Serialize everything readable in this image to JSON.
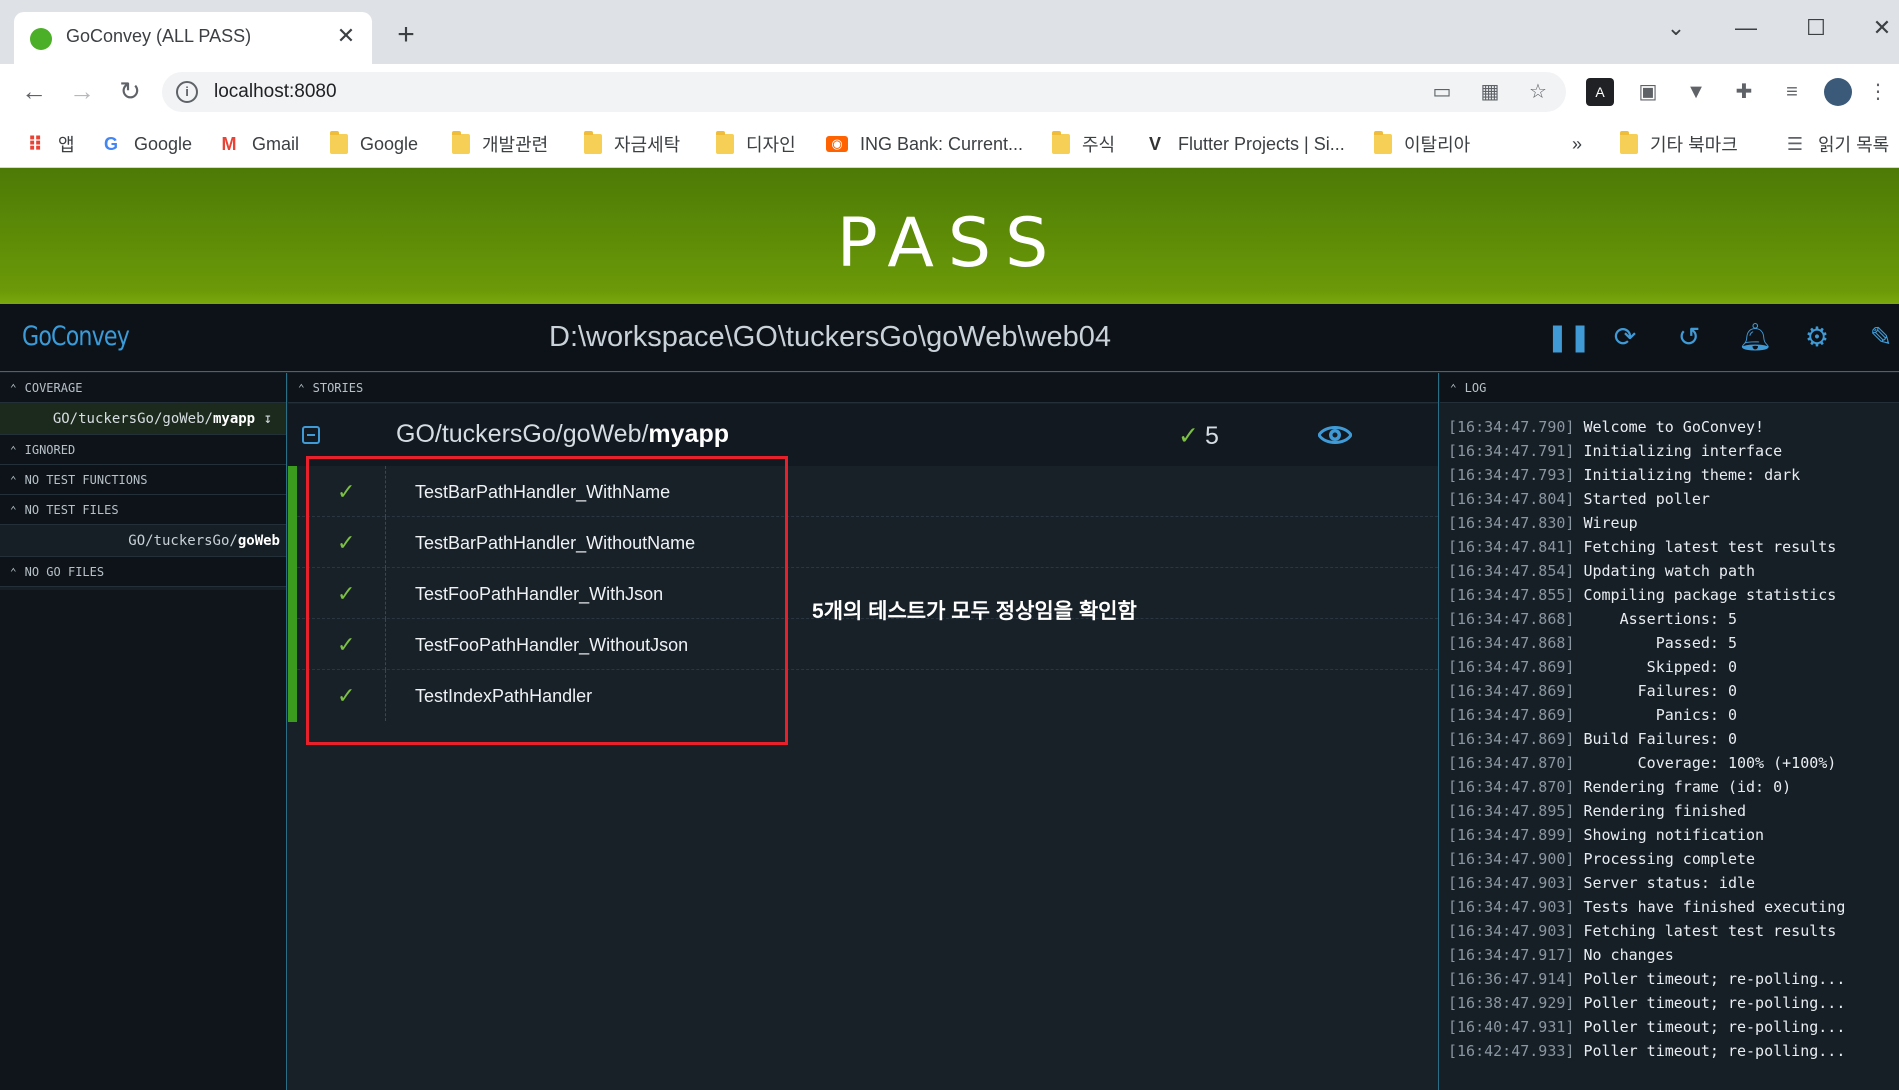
{
  "browser": {
    "tab_title": "GoConvey (ALL PASS)",
    "close_glyph": "✕",
    "new_tab_glyph": "+",
    "url": "localhost:8080",
    "bookmarks": [
      {
        "label": "앱",
        "icon": "apps-grid-icon"
      },
      {
        "label": "Google",
        "icon": "google-g-icon"
      },
      {
        "label": "Gmail",
        "icon": "gmail-icon"
      },
      {
        "label": "Google",
        "icon": "folder-icon"
      },
      {
        "label": "개발관련",
        "icon": "folder-icon"
      },
      {
        "label": "자금세탁",
        "icon": "folder-icon"
      },
      {
        "label": "디자인",
        "icon": "folder-icon"
      },
      {
        "label": "ING Bank: Current...",
        "icon": "ing-icon"
      },
      {
        "label": "주식",
        "icon": "folder-icon"
      },
      {
        "label": "Flutter Projects | Si...",
        "icon": "v-icon"
      },
      {
        "label": "이탈리아",
        "icon": "folder-icon"
      },
      {
        "label": "기타 북마크",
        "icon": "folder-icon"
      },
      {
        "label": "읽기 목록",
        "icon": "reading-list-icon"
      }
    ],
    "bookmarks_overflow": "»"
  },
  "banner": {
    "status": "PASS",
    "color": "#6b9908"
  },
  "header": {
    "logo": "GoConvey",
    "path": "D:\\workspace\\GO\\tuckersGo\\goWeb\\web04",
    "icons": [
      "pause-icon",
      "refresh-icon",
      "history-icon",
      "bell-icon",
      "gear-icon",
      "edit-icon"
    ]
  },
  "sidebar": {
    "coverage_title": "COVERAGE",
    "coverage_pkg_prefix": "GO/tuckersGo/goWeb/",
    "coverage_pkg_name": "myapp",
    "coverage_pkg_suffix": "↧",
    "ignored_title": "IGNORED",
    "no_test_functions_title": "NO TEST FUNCTIONS",
    "no_test_files_title": "NO TEST FILES",
    "no_test_files_pkg_prefix": "GO/tuckersGo/",
    "no_test_files_pkg_name": "goWeb",
    "no_go_files_title": "NO GO FILES"
  },
  "stories": {
    "title": "STORIES",
    "package_prefix": "GO/tuckersGo/goWeb/",
    "package_name": "myapp",
    "pass_mark": "✓",
    "pass_count": "5",
    "tests": [
      {
        "name": "TestBarPathHandler_WithName",
        "mark": "✓"
      },
      {
        "name": "TestBarPathHandler_WithoutName",
        "mark": "✓"
      },
      {
        "name": "TestFooPathHandler_WithJson",
        "mark": "✓"
      },
      {
        "name": "TestFooPathHandler_WithoutJson",
        "mark": "✓"
      },
      {
        "name": "TestIndexPathHandler",
        "mark": "✓"
      }
    ],
    "annotation_bold": "5",
    "annotation_text": "개의 테스트가 모두 정상임을 확인함",
    "highlight_color": "#e8202b",
    "pass_color": "#7bc043"
  },
  "log": {
    "title": "LOG",
    "lines": [
      {
        "ts": "[16:34:47.790]",
        "msg": "Welcome to GoConvey!"
      },
      {
        "ts": "[16:34:47.791]",
        "msg": "Initializing interface"
      },
      {
        "ts": "[16:34:47.793]",
        "msg": "Initializing theme: dark"
      },
      {
        "ts": "[16:34:47.804]",
        "msg": "Started poller"
      },
      {
        "ts": "[16:34:47.830]",
        "msg": "Wireup"
      },
      {
        "ts": "[16:34:47.841]",
        "msg": "Fetching latest test results"
      },
      {
        "ts": "[16:34:47.854]",
        "msg": "Updating watch path"
      },
      {
        "ts": "[16:34:47.855]",
        "msg": "Compiling package statistics"
      },
      {
        "ts": "[16:34:47.868]",
        "msg": "    Assertions: 5"
      },
      {
        "ts": "[16:34:47.868]",
        "msg": "        Passed: 5"
      },
      {
        "ts": "[16:34:47.869]",
        "msg": "       Skipped: 0"
      },
      {
        "ts": "[16:34:47.869]",
        "msg": "      Failures: 0"
      },
      {
        "ts": "[16:34:47.869]",
        "msg": "        Panics: 0"
      },
      {
        "ts": "[16:34:47.869]",
        "msg": "Build Failures: 0"
      },
      {
        "ts": "[16:34:47.870]",
        "msg": "      Coverage: 100% (+100%)"
      },
      {
        "ts": "[16:34:47.870]",
        "msg": "Rendering frame (id: 0)"
      },
      {
        "ts": "[16:34:47.895]",
        "msg": "Rendering finished"
      },
      {
        "ts": "[16:34:47.899]",
        "msg": "Showing notification"
      },
      {
        "ts": "[16:34:47.900]",
        "msg": "Processing complete"
      },
      {
        "ts": "[16:34:47.903]",
        "msg": "Server status: idle"
      },
      {
        "ts": "[16:34:47.903]",
        "msg": "Tests have finished executing"
      },
      {
        "ts": "[16:34:47.903]",
        "msg": "Fetching latest test results"
      },
      {
        "ts": "[16:34:47.917]",
        "msg": "No changes"
      },
      {
        "ts": "[16:36:47.914]",
        "msg": "Poller timeout; re-polling..."
      },
      {
        "ts": "[16:38:47.929]",
        "msg": "Poller timeout; re-polling..."
      },
      {
        "ts": "[16:40:47.931]",
        "msg": "Poller timeout; re-polling..."
      },
      {
        "ts": "[16:42:47.933]",
        "msg": "Poller timeout; re-polling..."
      }
    ]
  }
}
